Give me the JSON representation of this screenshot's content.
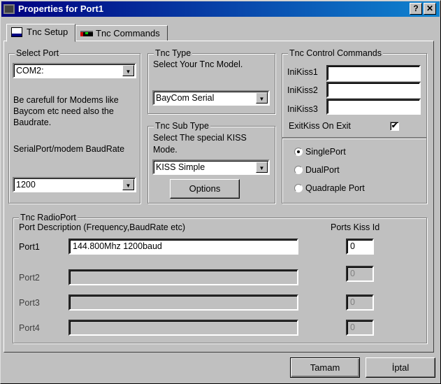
{
  "window": {
    "title": "Properties for Port1",
    "help_label": "?",
    "close_label": "✕"
  },
  "tabs": [
    {
      "label": "Tnc Setup"
    },
    {
      "label": "Tnc Commands"
    }
  ],
  "select_port": {
    "legend": "Select Port",
    "value": "COM2:",
    "note": [
      "Be carefull for Modems like",
      "Baycom etc need also the",
      "Baudrate."
    ],
    "baud_label": "SerialPort/modem BaudRate",
    "baud_value": "1200"
  },
  "tnc_type": {
    "legend": "Tnc Type",
    "label": "Select Your Tnc Model.",
    "value": "BayCom Serial"
  },
  "tnc_sub_type": {
    "legend": "Tnc Sub Type",
    "label": [
      "Select The special KISS",
      "Mode."
    ],
    "value": "KISS Simple",
    "options_label": "Options"
  },
  "control": {
    "legend": "Tnc Control Commands",
    "kiss": [
      {
        "label": "IniKiss1",
        "value": ""
      },
      {
        "label": "IniKiss2",
        "value": ""
      },
      {
        "label": "IniKiss3",
        "value": ""
      }
    ],
    "exit_label": "ExitKiss On Exit",
    "exit_checked": true
  },
  "port_mode": {
    "options": [
      {
        "label": "SinglePort",
        "selected": true
      },
      {
        "label": "DualPort",
        "selected": false
      },
      {
        "label": "Quadraple Port",
        "selected": false
      }
    ]
  },
  "radio": {
    "legend": "Tnc RadioPort",
    "desc_header": "Port Description (Frequency,BaudRate etc)",
    "kiss_header": "Ports Kiss Id",
    "ports": [
      {
        "label": "Port1",
        "desc": "144.800Mhz 1200baud",
        "kiss": "0"
      },
      {
        "label": "Port2",
        "desc": "",
        "kiss": "0"
      },
      {
        "label": "Port3",
        "desc": "",
        "kiss": "0"
      },
      {
        "label": "Port4",
        "desc": "",
        "kiss": "0"
      }
    ]
  },
  "buttons": {
    "ok": "Tamam",
    "cancel": "İptal"
  }
}
